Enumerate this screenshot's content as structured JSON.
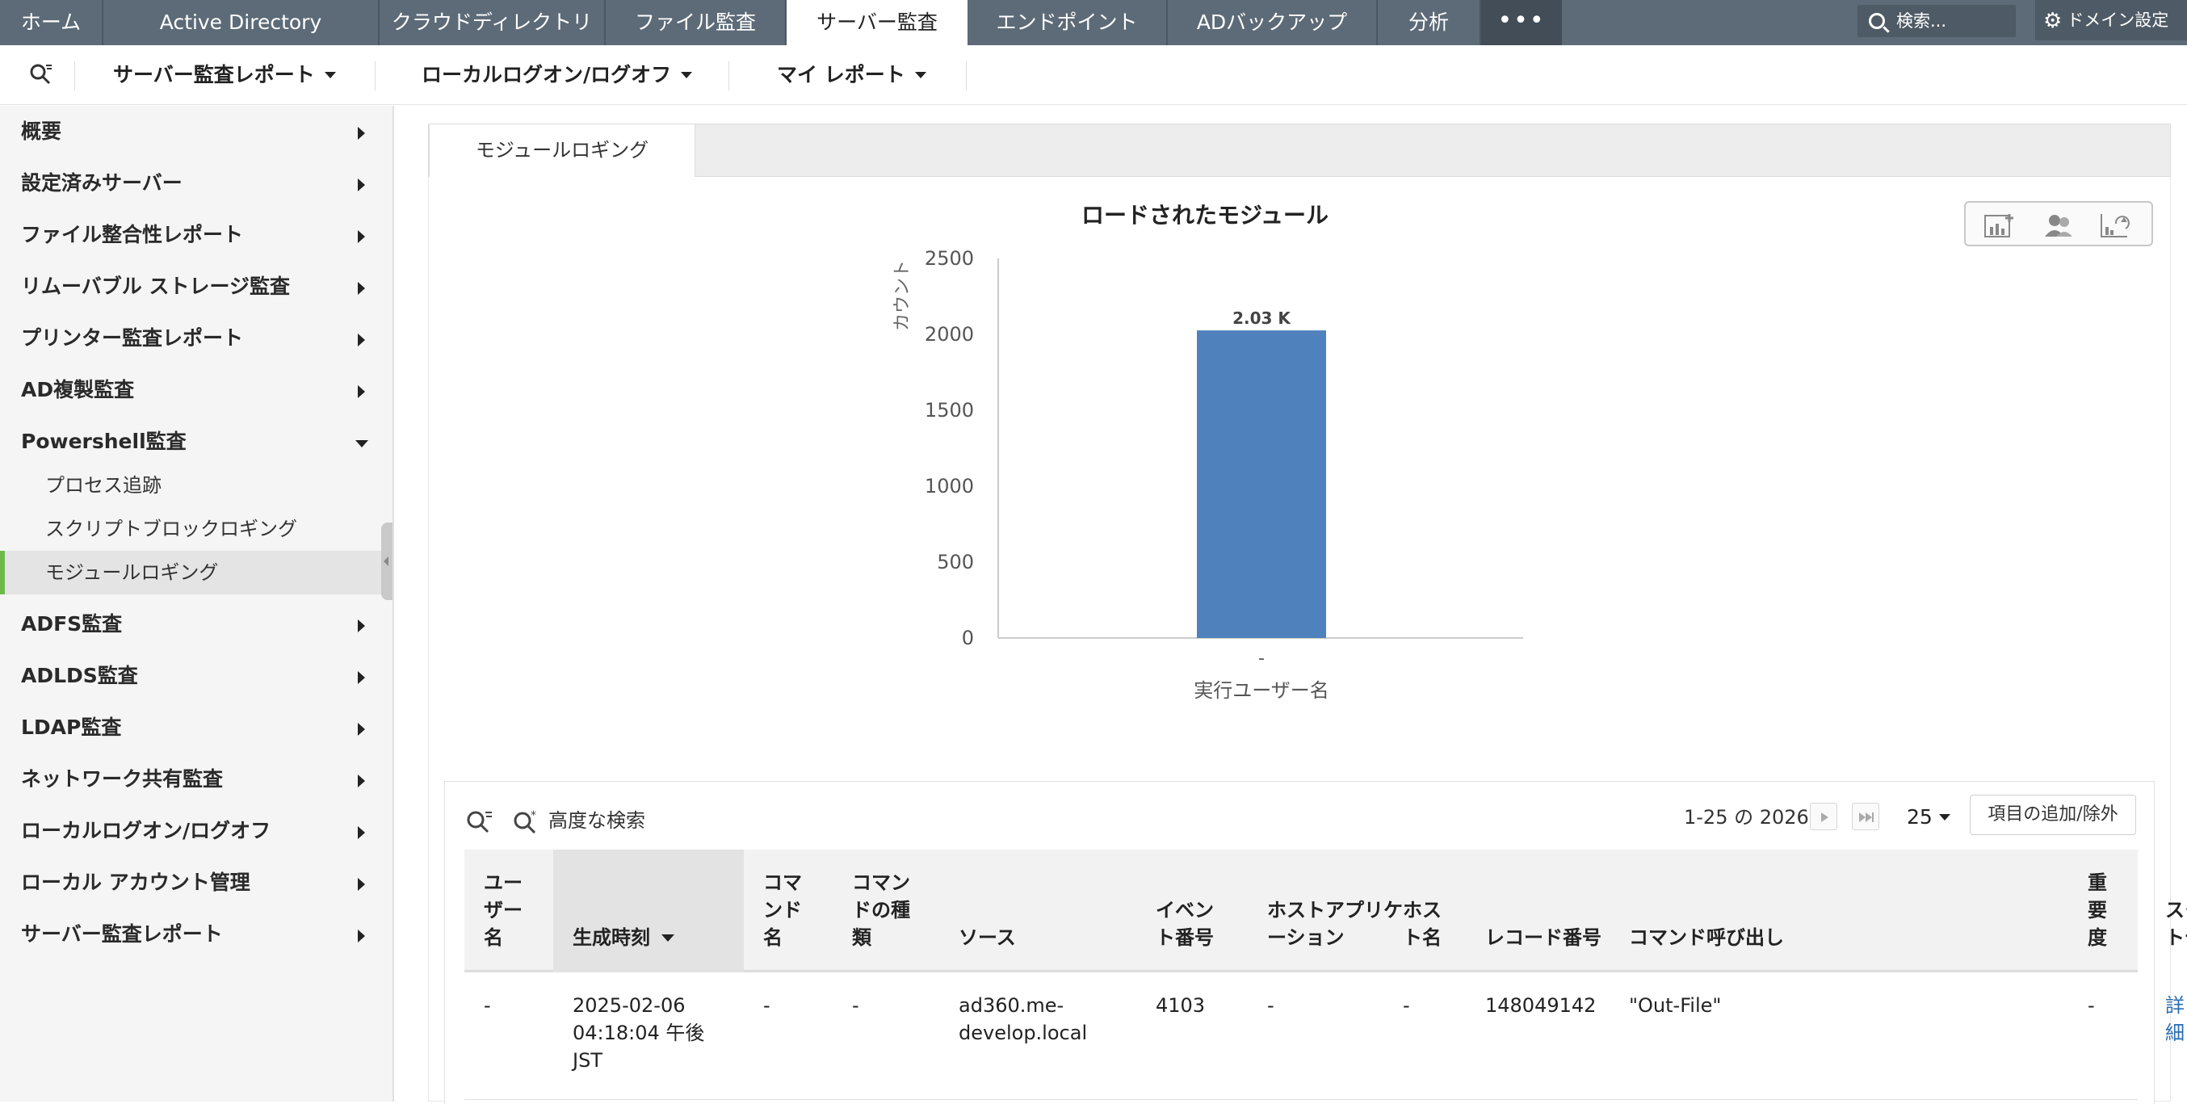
{
  "topnav": {
    "tabs": [
      {
        "label": "ホーム"
      },
      {
        "label": "Active Directory"
      },
      {
        "label": "クラウドディレクトリ"
      },
      {
        "label": "ファイル監査"
      },
      {
        "label": "サーバー監査"
      },
      {
        "label": "エンドポイント"
      },
      {
        "label": "ADバックアップ"
      },
      {
        "label": "分析"
      }
    ],
    "active_tab": "サーバー監査",
    "more_label": "•••",
    "search_placeholder": "検索...",
    "domain_settings": "ドメイン設定"
  },
  "subnav": {
    "menus": [
      {
        "label": "サーバー監査レポート"
      },
      {
        "label": "ローカルログオン/ログオフ"
      },
      {
        "label": "マイ レポート"
      }
    ]
  },
  "sidebar": {
    "items": [
      {
        "label": "概要"
      },
      {
        "label": "設定済みサーバー"
      },
      {
        "label": "ファイル整合性レポート"
      },
      {
        "label": "リムーバブル ストレージ監査"
      },
      {
        "label": "プリンター監査レポート"
      },
      {
        "label": "AD複製監査"
      },
      {
        "label": "Powershell監査"
      },
      {
        "label": "ADFS監査"
      },
      {
        "label": "ADLDS監査"
      },
      {
        "label": "LDAP監査"
      },
      {
        "label": "ネットワーク共有監査"
      },
      {
        "label": "ローカルログオン/ログオフ"
      },
      {
        "label": "ローカル アカウント管理"
      },
      {
        "label": "サーバー監査レポート"
      }
    ],
    "powershell_subitems": [
      {
        "label": "プロセス追跡"
      },
      {
        "label": "スクリプトブロックロギング"
      },
      {
        "label": "モジュールロギング"
      }
    ],
    "active_subitem": "モジュールロギング"
  },
  "main": {
    "tab_label": "モジュールロギング"
  },
  "chart_data": {
    "type": "bar",
    "title": "ロードされたモジュール",
    "xlabel": "実行ユーザー名",
    "ylabel": "カウント",
    "categories": [
      "-"
    ],
    "values": [
      2026
    ],
    "data_labels": [
      "2.03 K"
    ],
    "yticks": [
      0,
      500,
      1000,
      1500,
      2000,
      2500
    ],
    "ylim": [
      0,
      2500
    ],
    "bar_color": "#4f81bd",
    "grid": false,
    "legend": "none"
  },
  "table": {
    "advanced_search": "高度な検索",
    "pagination": "1-25 の 2026",
    "per_page": "25",
    "add_remove_columns": "項目の追加/除外",
    "columns": [
      "ユーザー名",
      "生成時刻",
      "コマンド名",
      "コマンドの種類",
      "ソース",
      "イベント番号",
      "ホストアプリケーション",
      "ホスト名",
      "レコード番号",
      "コマンド呼び出し",
      "重要度",
      "スクリプトデータ"
    ],
    "sorted_column": "生成時刻",
    "rows": [
      {
        "user": "-",
        "time": "2025-02-06 04:18:04 午後 JST",
        "command_name": "-",
        "command_type": "-",
        "source": "ad360.me-develop.local",
        "event_id": "4103",
        "host_app": "-",
        "host_name": "-",
        "record": "148049142",
        "invocation": "\"Out-File\"",
        "severity": "-",
        "script_data": "詳細"
      }
    ]
  }
}
